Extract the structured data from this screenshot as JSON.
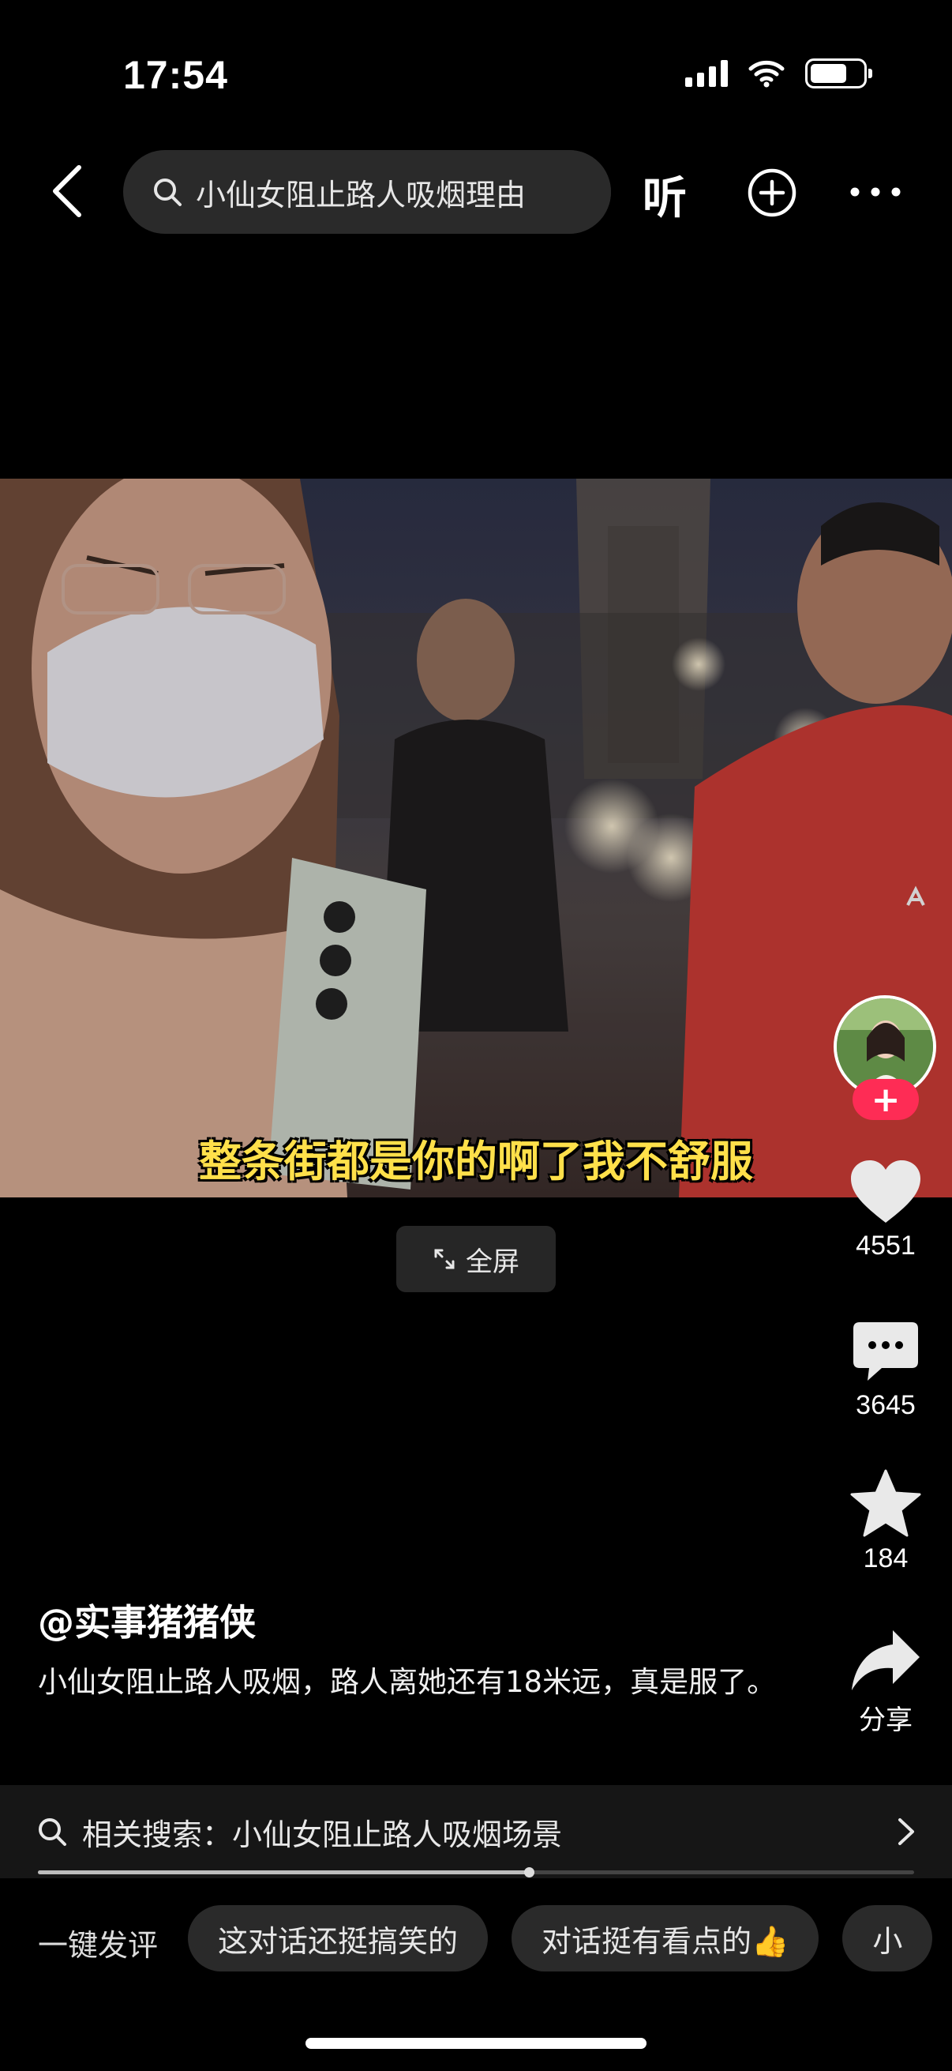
{
  "status_bar": {
    "time": "17:54"
  },
  "top_nav": {
    "search_query": "小仙女阻止路人吸烟理由",
    "listen_label": "听"
  },
  "video": {
    "subtitle": "整条街都是你的啊了我不舒服",
    "fullscreen_label": "全屏"
  },
  "actions": {
    "like_count": "4551",
    "comment_count": "3645",
    "favorite_count": "184",
    "share_label": "分享",
    "follow_symbol": "+"
  },
  "post": {
    "author": "@实事猪猪侠",
    "description": "小仙女阻止路人吸烟，路人离她还有18米远，真是服了。"
  },
  "related_search": {
    "label": "相关搜索：小仙女阻止路人吸烟场景",
    "playback_progress": 0.56
  },
  "quick_comment": {
    "label": "一键发评",
    "chips": [
      "这对话还挺搞笑的",
      "对话挺有看点的👍",
      "小"
    ]
  },
  "colors": {
    "accent": "#fe2c55",
    "subtitle": "#ffe04a",
    "surface": "#2a2a2a"
  }
}
